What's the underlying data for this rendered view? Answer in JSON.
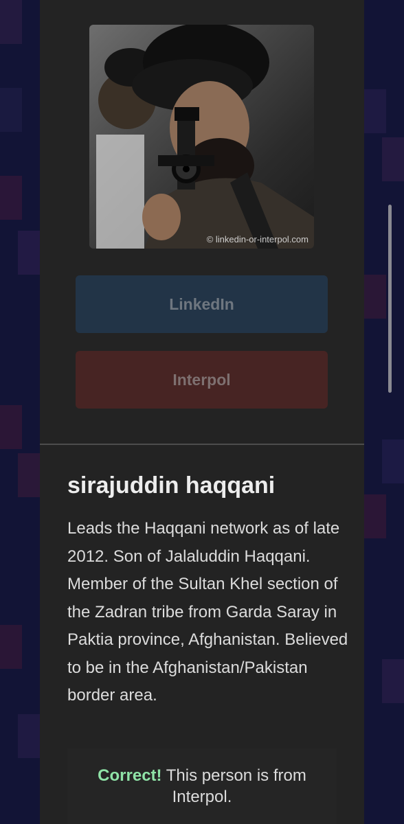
{
  "photo": {
    "watermark": "© linkedin-or-interpol.com",
    "subject": "person-photo"
  },
  "buttons": {
    "linkedin_label": "LinkedIn",
    "interpol_label": "Interpol"
  },
  "profile": {
    "name": "sirajuddin haqqani",
    "description": "Leads the Haqqani network as of late 2012. Son of Jalaluddin Haqqani. Member of the Sultan Khel section of the Zadran tribe from Garda Saray in Paktia province, Afghanistan. Believed to be in the Afghanistan/Pakistan border area."
  },
  "result": {
    "verdict": "Correct!",
    "message": " This person is from Interpol."
  },
  "colors": {
    "background": "#121436",
    "panel": "#232323",
    "linkedin_button": "#223447",
    "interpol_button": "#472423",
    "correct_text": "#8fe3a7"
  }
}
